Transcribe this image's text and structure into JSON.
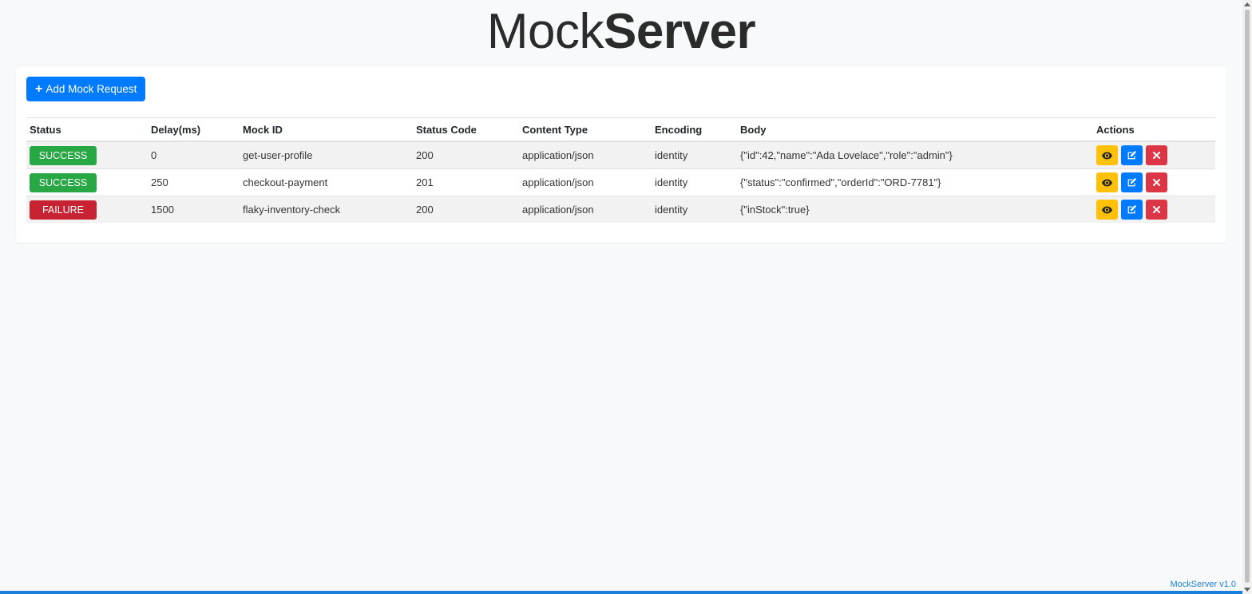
{
  "app": {
    "title_light": "Mock",
    "title_bold": "Server",
    "version": "MockServer v1.0"
  },
  "toolbar": {
    "add_label": "Add Mock Request",
    "add_icon": "plus-icon"
  },
  "table": {
    "headers": {
      "status": "Status",
      "delay": "Delay(ms)",
      "mock_id": "Mock ID",
      "status_code": "Status Code",
      "content_type": "Content Type",
      "encoding": "Encoding",
      "body": "Body",
      "actions": "Actions"
    },
    "rows": [
      {
        "status": "SUCCESS",
        "delay": "0",
        "mock_id": "get-user-profile",
        "status_code": "200",
        "content_type": "application/json",
        "encoding": "identity",
        "body": "{\"id\":42,\"name\":\"Ada Lovelace\",\"role\":\"admin\"}"
      },
      {
        "status": "SUCCESS",
        "delay": "250",
        "mock_id": "checkout-payment",
        "status_code": "201",
        "content_type": "application/json",
        "encoding": "identity",
        "body": "{\"status\":\"confirmed\",\"orderId\":\"ORD-7781\"}"
      },
      {
        "status": "FAILURE",
        "delay": "1500",
        "mock_id": "flaky-inventory-check",
        "status_code": "200",
        "content_type": "application/json",
        "encoding": "identity",
        "body": "{\"inStock\":true}"
      }
    ],
    "actions": [
      "eye-icon",
      "edit-icon",
      "close-icon"
    ]
  },
  "colors": {
    "primary": "#007bff",
    "success": "#28a745",
    "failure": "#c82333",
    "warning": "#ffc107",
    "danger": "#dc3545"
  }
}
